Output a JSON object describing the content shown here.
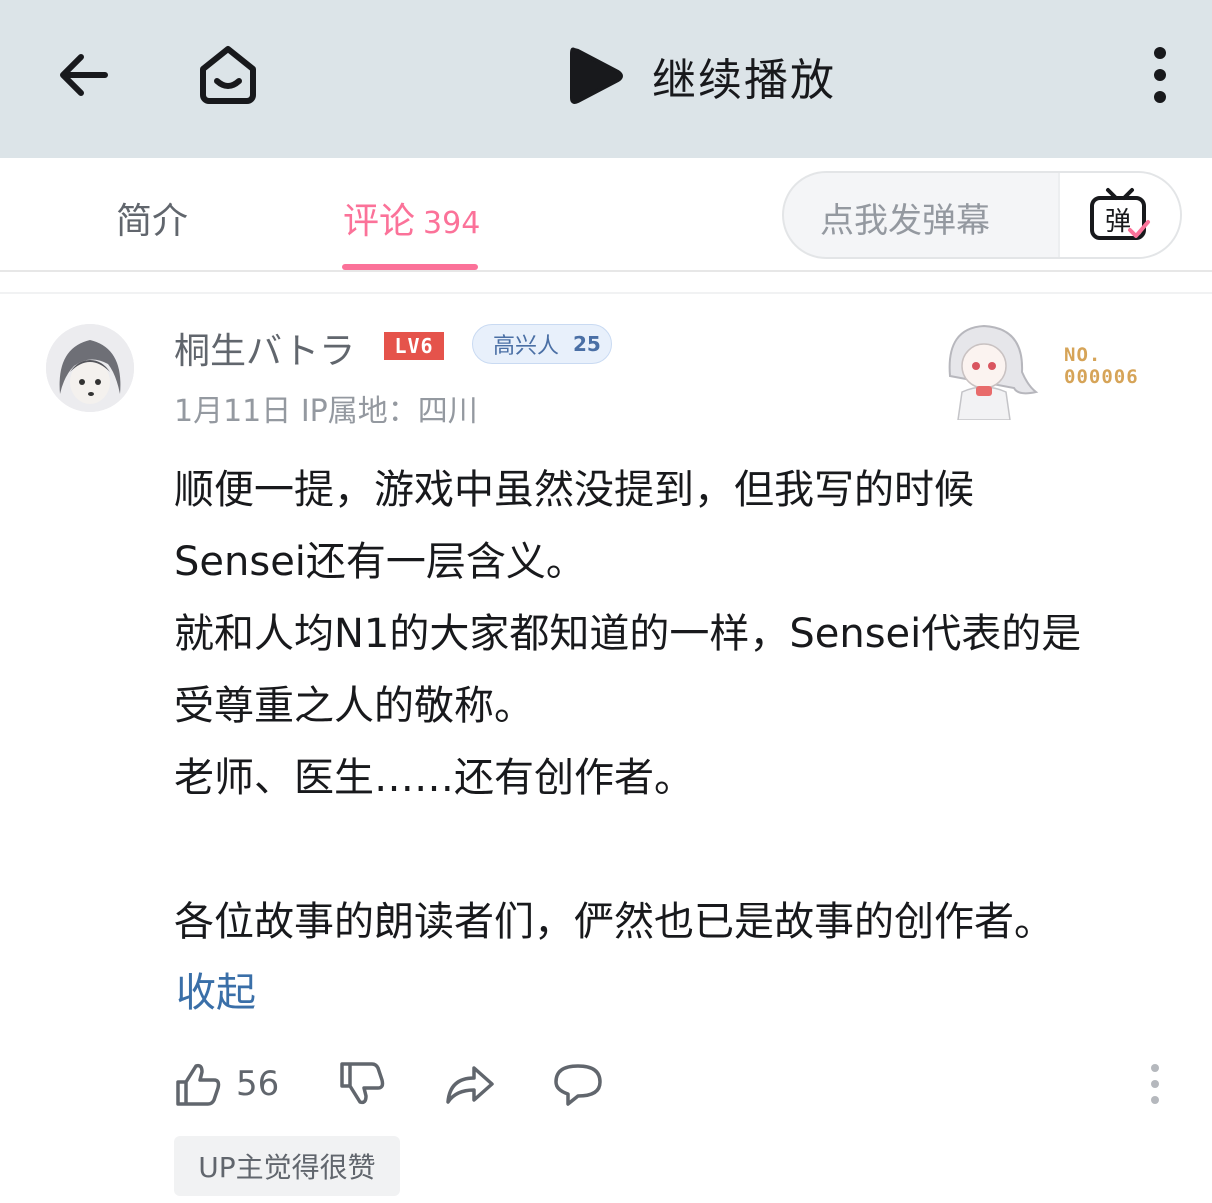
{
  "topbar": {
    "back_icon": "arrow-left-icon",
    "home_icon": "home-face-icon",
    "play_icon": "play-icon",
    "play_label": "继续播放",
    "more_icon": "more-vertical-icon"
  },
  "tabs": [
    {
      "label": "简介"
    },
    {
      "label": "评论",
      "count": "394",
      "active": true
    }
  ],
  "danmaku": {
    "placeholder": "点我发弹幕",
    "button_icon": "danmaku-tv-icon",
    "button_glyph": "弹"
  },
  "comment": {
    "username": "桐生バトラ",
    "level": "LV6",
    "medal": {
      "name": "高兴人",
      "level": "25"
    },
    "date": "1月11日",
    "ip_location": "IP属地：四川",
    "fan_number": {
      "prefix": "NO.",
      "number": "000006"
    },
    "lines": [
      "顺便一提，游戏中虽然没提到，但我写的时候",
      "Sensei还有一层含义。",
      "就和人均N1的大家都知道的一样，Sensei代表的是",
      "受尊重之人的敬称。",
      "老师、医生……还有创作者。",
      "",
      "各位故事的朗读者们，俨然也已是故事的创作者。"
    ],
    "collapse_label": "收起",
    "like_count": "56",
    "up_tag": "UP主觉得很赞"
  },
  "colors": {
    "accent": "#fb7299",
    "topbar_bg": "#dce4e8",
    "link": "#3a6fa8",
    "level_badge": "#e5534b",
    "fan_number": "#d6a458"
  }
}
